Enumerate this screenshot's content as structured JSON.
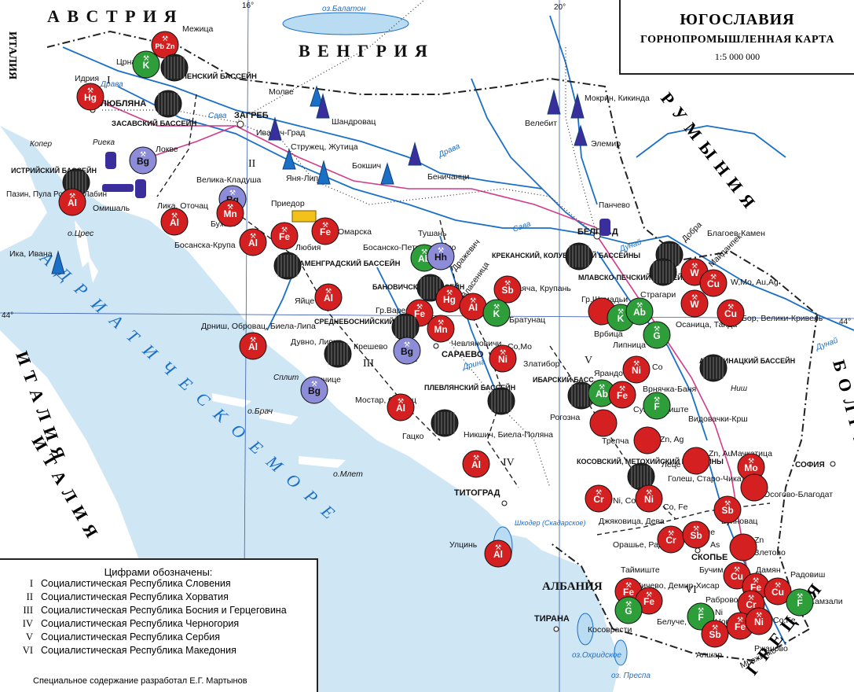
{
  "title": {
    "main": "ЮГОСЛАВИЯ",
    "subtitle": "ГОРНОПРОМЫШЛЕННАЯ КАРТА",
    "scale": "1:5 000 000"
  },
  "countries": {
    "austria": "А В С Т Р И Я",
    "hungary": "В Е Н Г Р И Я",
    "romania": "Р У М Ы Н И Я",
    "bulgaria": "Б О Л Г А Р И Я",
    "greece": "Г Р Е Ц И Я",
    "italy_nw": "ИТАЛИЯ",
    "italy_w": "И Т А Л И Я",
    "italy_sw": "И Т А Л И Я",
    "albania": "АЛБАНИЯ",
    "sea": "А Д Р И А Т И Ч Е С К О Е   М О Р Е"
  },
  "grid_labels": {
    "lon16": "16°",
    "lon20": "20°",
    "lat44_w": "44°",
    "lat44_e": "44°"
  },
  "waters": {
    "balaton": "оз.Балатон",
    "drava1": "Драва",
    "drava2": "Драва",
    "sava1": "Сава",
    "sava2": "Сава",
    "dunaj1": "Дунай",
    "dunaj2": "Дунай",
    "drina": "Дрина",
    "shkoder": "Шкодер (Скадарское)",
    "ohrid": "оз.Охридское",
    "prespa": "оз. Преспа"
  },
  "republics": {
    "r1": "I",
    "r2": "II",
    "r3": "III",
    "r4": "IV",
    "r5": "V",
    "r6": "VI"
  },
  "cities": {
    "ljubljana": "ЛЮБЛЯНА",
    "zagreb": "ЗАГРЕБ",
    "belgrad": "БЕЛГРАД",
    "sarajevo": "САРАЕВО",
    "titograd": "ТИТОГРАД",
    "skopje": "СКОПЬЕ",
    "tirana": "ТИРАНА",
    "sofia": "СОФИЯ",
    "split": "Сплит",
    "rijeka": "Риека",
    "koper": "Копер",
    "nish": "Ниш",
    "pancevo": "Панчево"
  },
  "places": [
    "Межица",
    "Црна",
    "Идрия",
    "ВЕЛЕНСКИЙ БАССЕЙН",
    "ЗАСАВСКИЙ БАССЕЙН",
    "Молве",
    "Иванич-Град",
    "Шандровац",
    "Стружец, Жутица",
    "Бокшич",
    "Яня-Липа",
    "Беничанци",
    "Велебит",
    "Мокрин, Кикинда",
    "Элемир",
    "Локве",
    "ИСТРИЙСКИЙ БАССЕЙН",
    "Пазин, Пула Ровинь, Лабин",
    "Омишаль",
    "Лика, Оточац",
    "Велика-Кладуша",
    "Бужим",
    "Приедор",
    "Омарска",
    "Любия",
    "Босанска-Крупа",
    "о.Црес",
    "Ика, Ивана",
    "КАМЕНГРАДСКИЙ БАССЕЙН",
    "Босанско-Петрово-Село",
    "Тушань",
    "Дражевич",
    "Яйце",
    "БАНОВИЧСКИЙ БАССЕЙН",
    "Гр.Вареш",
    "СРЕДНЕБОСНИЙСКИЙ БАССЕЙН",
    "Власеница",
    "КРЕКАНСКИЙ, КОЛУБАРСКИЙ БАССЕЙНЫ",
    "Заяча, Крупань",
    "Братунац",
    "МЛАВСКО-ПЕЧСКИЙ БАССЕЙН",
    "Гр.Шумадьи",
    "Страгари",
    "Врбица",
    "Липница",
    "Оcаница, Танда",
    "Бор, Велики-Кривель",
    "Добра",
    "Благоев-Камен",
    "Майданпек",
    "W,Mo, Au,Ag",
    "Дрниш, Обровац, Биела-Липа",
    "Дувно, Ливно",
    "Крешево",
    "Чевляновичи",
    "Co,Mo",
    "Златибор",
    "Ричице",
    "Мостар, Столац",
    "о.Брач",
    "ПЛЕВЛЯНСКИЙ БАССЕЙН",
    "Гацко",
    "Никшич, Биела-Поляна",
    "о.Млет",
    "ИБАРСКИЙ БАСС.",
    "Ярандо",
    "Co",
    "Врнячка-Баня",
    "АЛЕКСИНАЦКИЙ БАССЕЙН",
    "Рогозна",
    "Суво-Рудиште",
    "Видовачки-Крш",
    "Трепча",
    "Zn, Ag",
    "Мачкатица",
    "КОСОВСКИЙ, МЕТОХИЙСКИЙ БАССЕЙНЫ",
    "Леце",
    "Zn, Au",
    "Голеш, Старо-Чикатово",
    "Осогово-Благодат",
    "Джяковица, Дева",
    "Ni, Co",
    "Co, Fe",
    "Буяновац",
    "Улцинь",
    "Лояне",
    "Орашье, Радуша",
    "As",
    "Zn",
    "Злетово",
    "Таймиште",
    "Бучим",
    "Дамян",
    "Радовиш",
    "Кичево, Демир-Хисар",
    "Раброво",
    "Хамзали",
    "Косоврасти",
    "Белуче, Равна-Нова",
    "Ni",
    "Co,Fe",
    "Алшар",
    "Ржаново",
    "Мрежичко",
    "Zn"
  ],
  "symbols": [
    {
      "kind": "deposit",
      "label": "Pb Zn",
      "color": "#d42020"
    },
    {
      "kind": "deposit",
      "label": "K",
      "color": "#2e9e3a"
    },
    {
      "kind": "deposit",
      "label": "Hg",
      "color": "#d42020"
    },
    {
      "kind": "deposit",
      "label": "Bg",
      "color": "#8c8cd8"
    },
    {
      "kind": "deposit",
      "label": "Al",
      "color": "#d42020"
    },
    {
      "kind": "deposit",
      "label": "Mn",
      "color": "#d42020"
    },
    {
      "kind": "deposit",
      "label": "Fe",
      "color": "#d42020"
    },
    {
      "kind": "deposit",
      "label": "Ab",
      "color": "#2e9e3a"
    },
    {
      "kind": "deposit",
      "label": "Hh",
      "color": "#8c8cd8"
    },
    {
      "kind": "deposit",
      "label": "Sb",
      "color": "#d42020"
    },
    {
      "kind": "deposit",
      "label": "W",
      "color": "#d42020"
    },
    {
      "kind": "deposit",
      "label": "Cu",
      "color": "#d42020"
    },
    {
      "kind": "deposit",
      "label": "G",
      "color": "#2e9e3a"
    },
    {
      "kind": "deposit",
      "label": "Ni",
      "color": "#d42020"
    },
    {
      "kind": "deposit",
      "label": "F",
      "color": "#2e9e3a"
    },
    {
      "kind": "deposit",
      "label": "Cr",
      "color": "#d42020"
    },
    {
      "kind": "deposit",
      "label": "Mo",
      "color": "#d42020"
    }
  ],
  "legend": {
    "heading": "Цифрами  обозначены:",
    "items": [
      {
        "num": "I",
        "text": "Социалистическая  Республика  Словения"
      },
      {
        "num": "II",
        "text": "Социалистическая  Республика  Хорватия"
      },
      {
        "num": "III",
        "text": "Социалистическая  Республика  Босния и Герцеговина"
      },
      {
        "num": "IV",
        "text": "Социалистическая  Республика  Черногория"
      },
      {
        "num": "V",
        "text": "Социалистическая  Республика  Сербия"
      },
      {
        "num": "VI",
        "text": "Социалистическая  Республика  Македония"
      }
    ],
    "credit": "Специальное содержание разработал  Е.Г. Мартынов"
  },
  "colors": {
    "sea": "#cfe6f5",
    "land": "#ffffff",
    "river": "#1a6fc7",
    "border": "#222222",
    "metal": "#d42020",
    "nonmetal": "#2e9e3a",
    "bauxite": "#8c8cd8",
    "oil": "#1a6fc7",
    "coal": "#222222",
    "highway": "#d23c8a"
  }
}
